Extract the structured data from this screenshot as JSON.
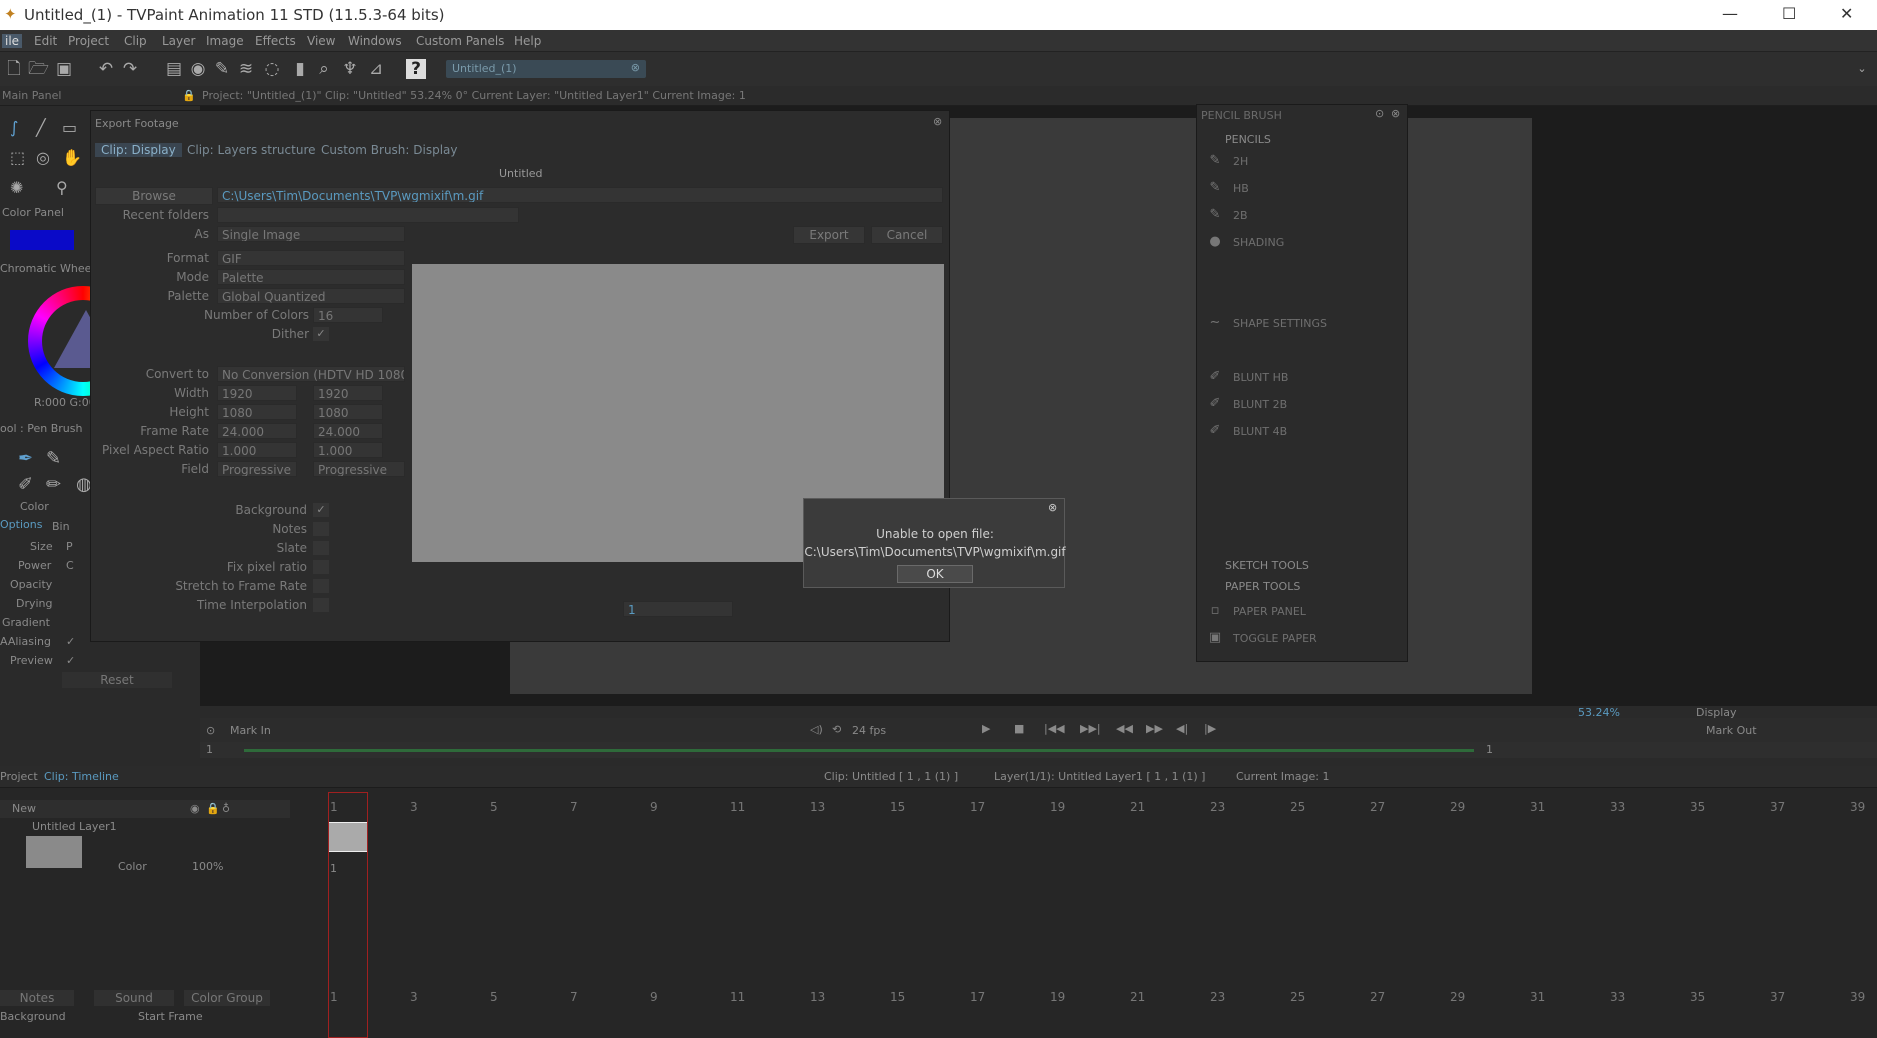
{
  "window": {
    "title": "Untitled_(1) - TVPaint Animation 11 STD (11.5.3-64 bits)"
  },
  "menu": [
    "ile",
    "Edit",
    "Project",
    "Clip",
    "Layer",
    "Image",
    "Effects",
    "View",
    "Windows",
    "Custom Panels",
    "Help"
  ],
  "project_tab": "Untitled_(1)",
  "info": {
    "main_panel": "Main Panel",
    "status": "Project: \"Untitled_(1)\"  Clip: \"Untitled\"   53.24%   0°  Current Layer: \"Untitled Layer1\"  Current Image: 1"
  },
  "left": {
    "color_panel": "Color Panel",
    "chromatic": "Chromatic Whee",
    "rgb": "R:000 G:00",
    "tool": "ool : Pen Brush",
    "color_tab": "Color",
    "options_tab": "Options",
    "bin_tab": "Bin",
    "opts": [
      {
        "label": "Size",
        "value": "P"
      },
      {
        "label": "Power",
        "value": "C"
      },
      {
        "label": "Opacity",
        "value": ""
      },
      {
        "label": "Drying",
        "value": ""
      },
      {
        "label": "Gradient",
        "value": ""
      },
      {
        "label": "AAliasing",
        "value": "✓"
      },
      {
        "label": "Preview",
        "value": "✓"
      }
    ],
    "reset": "Reset",
    "accent": "#0a0ac8"
  },
  "dialog": {
    "title": "Export Footage",
    "tabs": [
      "Clip: Display",
      "Clip: Layers structure",
      "Custom Brush: Display"
    ],
    "header": "Untitled",
    "browse": "Browse",
    "path": "C:\\Users\\Tim\\Documents\\TVP\\wgmixif\\m.gif",
    "recent_label": "Recent folders",
    "as_label": "As",
    "as_value": "Single Image",
    "export": "Export",
    "cancel": "Cancel",
    "format_label": "Format",
    "format": "GIF",
    "mode_label": "Mode",
    "mode": "Palette",
    "palette_label": "Palette",
    "palette": "Global Quantized",
    "ncolors_label": "Number of Colors",
    "ncolors": "16",
    "dither_label": "Dither",
    "dither": "✓",
    "convert_label": "Convert to",
    "convert": "No Conversion (HDTV  HD 1080p",
    "width_label": "Width",
    "width": "1920",
    "width2": "1920",
    "height_label": "Height",
    "height": "1080",
    "height2": "1080",
    "fps_label": "Frame Rate",
    "fps": "24.000",
    "fps2": "24.000",
    "par_label": "Pixel Aspect Ratio",
    "par": "1.000",
    "par2": "1.000",
    "field_label": "Field",
    "field": "Progressive",
    "field2": "Progressive",
    "bg_label": "Background",
    "bg": "✓",
    "notes_label": "Notes",
    "slate_label": "Slate",
    "fixpix_label": "Fix pixel ratio",
    "stretch_label": "Stretch to Frame Rate",
    "interp_label": "Time Interpolation",
    "frame": "1"
  },
  "msgbox": {
    "line1": "Unable to open file:",
    "line2": "C:\\Users\\Tim\\Documents\\TVP\\wgmixif\\m.gif",
    "ok": "OK"
  },
  "brush": {
    "title": "PENCIL BRUSH",
    "pencils": "PENCILS",
    "items": [
      "2H",
      "HB",
      "2B",
      "SHADING"
    ],
    "shape": "SHAPE SETTINGS",
    "blunt": [
      "BLUNT HB",
      "BLUNT 2B",
      "BLUNT 4B"
    ],
    "sketch": "SKETCH TOOLS",
    "paper": "PAPER TOOLS",
    "paper_panel": "PAPER PANEL",
    "toggle": "TOGGLE PAPER"
  },
  "playback": {
    "mark_in": "Mark In",
    "mark_out": "Mark Out",
    "fps": "24 fps",
    "zoom": "53.24%",
    "display": "Display",
    "in_val": "1",
    "out_val": "1"
  },
  "timeline": {
    "tab_project": "Project",
    "tab_clip": "Clip: Timeline",
    "clip_info": "Clip: Untitled [ 1 , 1  (1) ]",
    "layer_info": "Layer(1/1): Untitled Layer1 [ 1 , 1  (1) ]",
    "current": "Current Image: 1",
    "new": "New",
    "layer_name": "Untitled Layer1",
    "color": "Color",
    "opacity": "100%",
    "cell": "1",
    "ruler": [
      "1",
      "3",
      "5",
      "7",
      "9",
      "11",
      "13",
      "15",
      "17",
      "19",
      "21",
      "23",
      "25",
      "27",
      "29",
      "31",
      "33",
      "35",
      "37",
      "39"
    ],
    "notes": "Notes",
    "sound": "Sound",
    "color_group": "Color Group",
    "background": "Background",
    "start_frame": "Start Frame"
  }
}
